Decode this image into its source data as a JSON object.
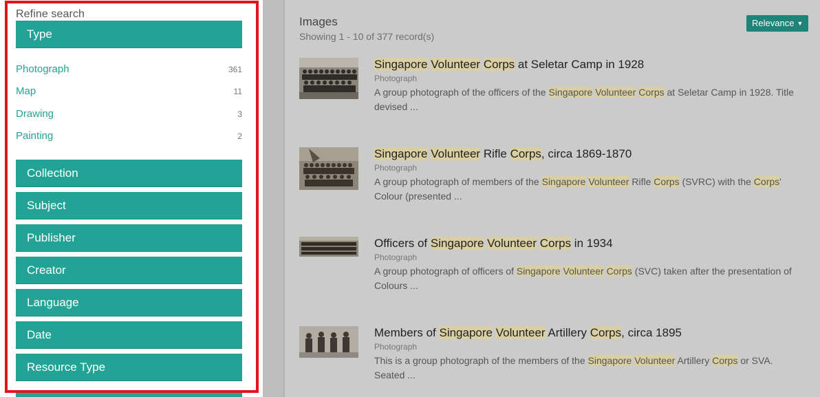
{
  "sidebar": {
    "title": "Refine search",
    "type_header": "Type",
    "type_items": [
      {
        "label": "Photograph",
        "count": "361"
      },
      {
        "label": "Map",
        "count": "11"
      },
      {
        "label": "Drawing",
        "count": "3"
      },
      {
        "label": "Painting",
        "count": "2"
      }
    ],
    "facets": [
      "Collection",
      "Subject",
      "Publisher",
      "Creator",
      "Language",
      "Date",
      "Resource Type"
    ]
  },
  "main": {
    "section_title": "Images",
    "showing": "Showing 1 - 10 of 377 record(s)",
    "sort_label": "Relevance",
    "results": [
      {
        "title_parts": [
          {
            "t": "Singapore",
            "h": true
          },
          {
            "t": " ",
            "h": false
          },
          {
            "t": "Volunteer",
            "h": true
          },
          {
            "t": " ",
            "h": false
          },
          {
            "t": "Corps",
            "h": true
          },
          {
            "t": " at Seletar Camp in 1928",
            "h": false
          }
        ],
        "type": "Photograph",
        "desc_parts": [
          {
            "t": "A group photograph of the officers of the ",
            "h": false
          },
          {
            "t": "Singapore",
            "h": true
          },
          {
            "t": " ",
            "h": false
          },
          {
            "t": "Volunteer",
            "h": true
          },
          {
            "t": " ",
            "h": false
          },
          {
            "t": "Corps",
            "h": true
          },
          {
            "t": " at Seletar Camp in 1928. Title devised ...",
            "h": false
          }
        ]
      },
      {
        "title_parts": [
          {
            "t": "Singapore",
            "h": true
          },
          {
            "t": " ",
            "h": false
          },
          {
            "t": "Volunteer",
            "h": true
          },
          {
            "t": " Rifle ",
            "h": false
          },
          {
            "t": "Corps",
            "h": true
          },
          {
            "t": ", circa 1869-1870",
            "h": false
          }
        ],
        "type": "Photograph",
        "desc_parts": [
          {
            "t": "A group photograph of members of the ",
            "h": false
          },
          {
            "t": "Singapore",
            "h": true
          },
          {
            "t": " ",
            "h": false
          },
          {
            "t": "Volunteer",
            "h": true
          },
          {
            "t": " Rifle ",
            "h": false
          },
          {
            "t": "Corps",
            "h": true
          },
          {
            "t": " (SVRC) with the ",
            "h": false
          },
          {
            "t": "Corps",
            "h": true
          },
          {
            "t": "' Colour (presented ...",
            "h": false
          }
        ]
      },
      {
        "title_parts": [
          {
            "t": "Officers of ",
            "h": false
          },
          {
            "t": "Singapore",
            "h": true
          },
          {
            "t": " ",
            "h": false
          },
          {
            "t": "Volunteer",
            "h": true
          },
          {
            "t": " ",
            "h": false
          },
          {
            "t": "Corps",
            "h": true
          },
          {
            "t": " in 1934",
            "h": false
          }
        ],
        "type": "Photograph",
        "desc_parts": [
          {
            "t": "A group photograph of officers of ",
            "h": false
          },
          {
            "t": "Singapore",
            "h": true
          },
          {
            "t": " ",
            "h": false
          },
          {
            "t": "Volunteer",
            "h": true
          },
          {
            "t": " ",
            "h": false
          },
          {
            "t": "Corps",
            "h": true
          },
          {
            "t": " (SVC) taken after the presentation of Colours ...",
            "h": false
          }
        ]
      },
      {
        "title_parts": [
          {
            "t": "Members of ",
            "h": false
          },
          {
            "t": "Singapore",
            "h": true
          },
          {
            "t": " ",
            "h": false
          },
          {
            "t": "Volunteer",
            "h": true
          },
          {
            "t": " Artillery ",
            "h": false
          },
          {
            "t": "Corps",
            "h": true
          },
          {
            "t": ", circa 1895",
            "h": false
          }
        ],
        "type": "Photograph",
        "desc_parts": [
          {
            "t": "This is a group photograph of the members of the ",
            "h": false
          },
          {
            "t": "Singapore",
            "h": true
          },
          {
            "t": " ",
            "h": false
          },
          {
            "t": "Volunteer",
            "h": true
          },
          {
            "t": " Artillery ",
            "h": false
          },
          {
            "t": "Corps",
            "h": true
          },
          {
            "t": " or SVA. Seated ...",
            "h": false
          }
        ]
      }
    ]
  },
  "colors": {
    "accent": "#23a396",
    "sort_button": "#1e8479",
    "highlight": "#d9cfa2",
    "frame": "#e4141b"
  },
  "icons": {
    "sort_caret": "caret-down-icon"
  }
}
